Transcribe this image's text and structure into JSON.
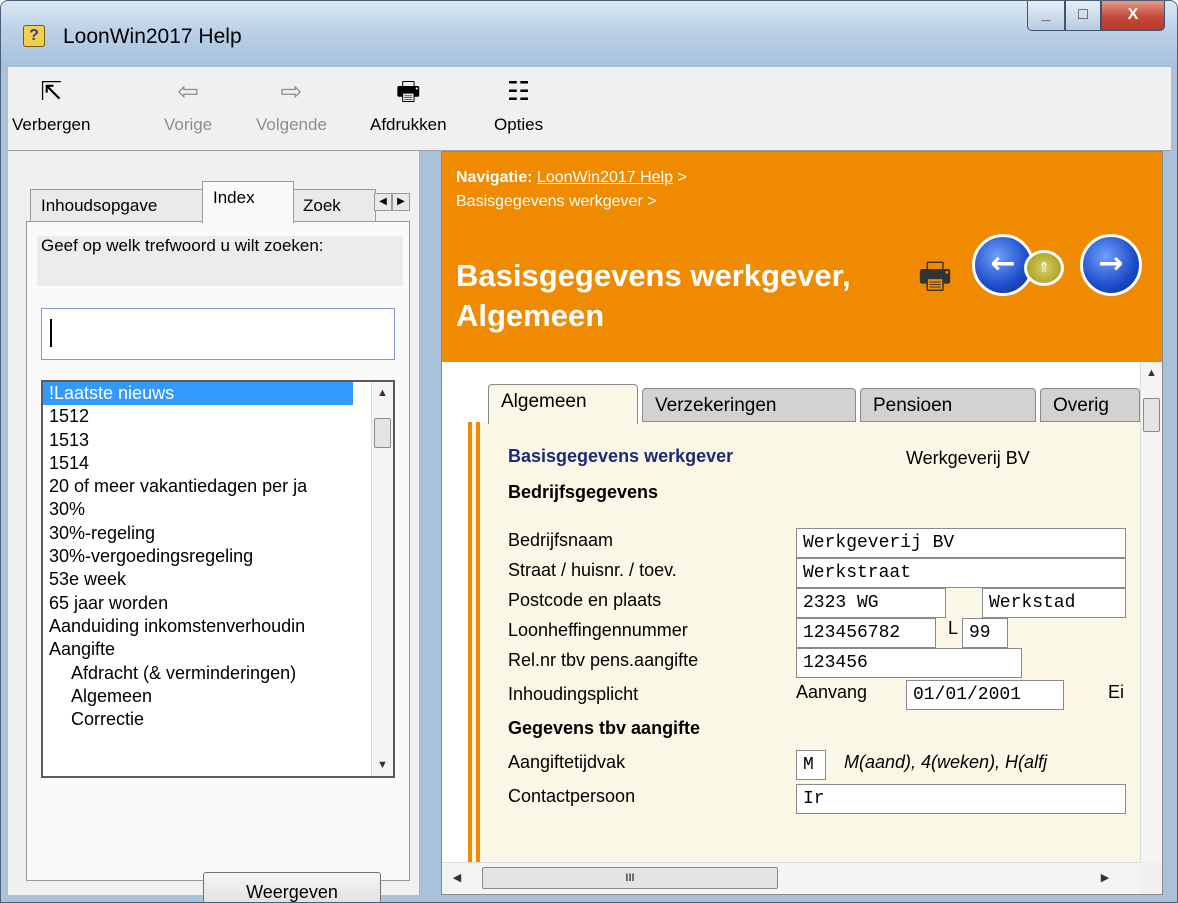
{
  "window": {
    "title": "LoonWin2017 Help",
    "controls": {
      "minimize": "_",
      "maximize": "□",
      "close": "X"
    }
  },
  "toolbar": {
    "items": [
      {
        "label": "Verbergen",
        "icon": "hide-pane-icon",
        "glyph": "⇱",
        "enabled": true
      },
      {
        "label": "Vorige",
        "icon": "back-arrow-icon",
        "glyph": "⇦",
        "enabled": false
      },
      {
        "label": "Volgende",
        "icon": "forward-arrow-icon",
        "glyph": "⇨",
        "enabled": false
      },
      {
        "label": "Afdrukken",
        "icon": "printer-icon",
        "glyph": "🖶",
        "enabled": true
      },
      {
        "label": "Opties",
        "icon": "options-icon",
        "glyph": "☷",
        "enabled": true
      }
    ]
  },
  "left": {
    "tabs": [
      "Inhoudsopgave",
      "Index",
      "Zoek"
    ],
    "active_tab": "Index",
    "prompt": "Geef op welk trefwoord u wilt zoeken:",
    "search_value": "",
    "list": [
      {
        "text": "!Laatste nieuws",
        "selected": true,
        "indent": false
      },
      {
        "text": "1512",
        "indent": false
      },
      {
        "text": "1513",
        "indent": false
      },
      {
        "text": "1514",
        "indent": false
      },
      {
        "text": "20 of meer vakantiedagen per ja",
        "indent": false
      },
      {
        "text": "30%",
        "indent": false
      },
      {
        "text": "30%-regeling",
        "indent": false
      },
      {
        "text": "30%-vergoedingsregeling",
        "indent": false
      },
      {
        "text": "53e week",
        "indent": false
      },
      {
        "text": "65 jaar worden",
        "indent": false
      },
      {
        "text": "Aanduiding inkomstenverhoudin",
        "indent": false
      },
      {
        "text": "Aangifte",
        "indent": false
      },
      {
        "text": "Afdracht (& verminderingen)",
        "indent": true
      },
      {
        "text": "Algemeen",
        "indent": true
      },
      {
        "text": "Correctie",
        "indent": true
      }
    ],
    "button": "Weergeven"
  },
  "right": {
    "nav_label": "Navigatie:",
    "nav_link": "LoonWin2017 Help",
    "nav_sep": ">",
    "nav_sub": "Basisgegevens werkgever >",
    "title": "Basisgegevens werkgever, Algemeen",
    "colors": {
      "banner": "#f08a00",
      "heading": "#1b2a78"
    },
    "doc_tabs": [
      "Algemeen",
      "Verzekeringen",
      "Pensioen",
      "Overig"
    ],
    "active_doc_tab": "Algemeen",
    "section_title": "Basisgegevens werkgever",
    "company_name_display": "Werkgeverij BV",
    "bedrijfsgegevens": "Bedrijfsgegevens",
    "fields": {
      "bedrijfsnaam": {
        "label": "Bedrijfsnaam",
        "value": "Werkgeverij BV"
      },
      "straat": {
        "label": "Straat / huisnr. / toev.",
        "value": "Werkstraat"
      },
      "postcode": {
        "label": "Postcode en plaats",
        "postcode": "2323 WG",
        "plaats": "Werkstad"
      },
      "loonheffingen": {
        "label": "Loonheffingennummer",
        "value": "123456782",
        "l_label": "L",
        "l_value": "99"
      },
      "relnr": {
        "label": "Rel.nr tbv pens.aangifte",
        "value": "123456"
      },
      "inhoudingsplicht": {
        "label": "Inhoudingsplicht",
        "aanvang_label": "Aanvang",
        "aanvang_value": "01/01/2001",
        "eind_label": "Ei"
      }
    },
    "gegevens_aangifte": "Gegevens tbv aangifte",
    "aangiftetijdvak": {
      "label": "Aangiftetijdvak",
      "value": "M",
      "hint": "M(aand),  4(weken), H(alfj"
    },
    "contactpersoon": {
      "label": "Contactpersoon",
      "value": "Ir"
    },
    "hscroll_thumb": "III"
  }
}
